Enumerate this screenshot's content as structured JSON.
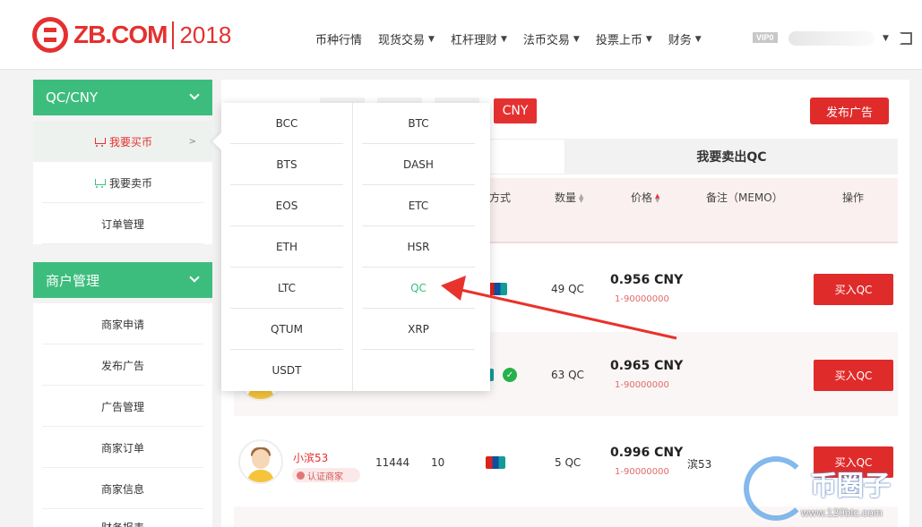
{
  "header": {
    "logo_text": "ZB.COM",
    "logo_year": "2018",
    "nav": [
      {
        "label": "币种行情",
        "caret": false
      },
      {
        "label": "现货交易",
        "caret": true
      },
      {
        "label": "杠杆理财",
        "caret": true
      },
      {
        "label": "法币交易",
        "caret": true
      },
      {
        "label": "投票上币",
        "caret": true
      },
      {
        "label": "财务",
        "caret": true
      }
    ],
    "vip_label": "VIP0"
  },
  "sidebar": {
    "group1_title": "QC/CNY",
    "group1_items": [
      {
        "label": "我要买币",
        "active": true,
        "icon": "cart-icon"
      },
      {
        "label": "我要卖币",
        "active": false,
        "icon": "cart-icon"
      },
      {
        "label": "订单管理",
        "active": false
      }
    ],
    "active_arrow": ">",
    "group2_title": "商户管理",
    "group2_items": [
      {
        "label": "商家申请"
      },
      {
        "label": "发布广告"
      },
      {
        "label": "广告管理"
      },
      {
        "label": "商家订单"
      },
      {
        "label": "商家信息"
      },
      {
        "label": "财务报表"
      }
    ]
  },
  "currency_selector": {
    "selected": "CNY",
    "publish_label": "发布广告"
  },
  "tabs": {
    "sell_label": "我要卖出QC"
  },
  "table": {
    "headers": {
      "payment": "款方式",
      "quantity": "数量",
      "price": "价格",
      "memo": "备注（MEMO）",
      "action": "操作"
    },
    "rows": [
      {
        "quantity": "49 QC",
        "price": "0.956 CNY",
        "range": "1-90000000",
        "button": "买入QC"
      },
      {
        "quantity": "63 QC",
        "price": "0.965 CNY",
        "range": "1-90000000",
        "button": "买入QC"
      },
      {
        "merchant": "小滨53",
        "badge": "认证商家",
        "orders": "11444",
        "rate": "10",
        "quantity": "5 QC",
        "price": "0.996 CNY",
        "range": "1-90000000",
        "memo": "滨53",
        "button": "买入QC"
      }
    ]
  },
  "dropdown": {
    "left": [
      "BCC",
      "BTS",
      "EOS",
      "ETH",
      "LTC",
      "QTUM",
      "USDT"
    ],
    "right": [
      "BTC",
      "DASH",
      "ETC",
      "HSR",
      "QC",
      "XRP"
    ],
    "active": "QC"
  },
  "watermark": {
    "title": "币圈子",
    "url": "www.120btc.com"
  },
  "colors": {
    "brand_red": "#e53030",
    "accent_green": "#3dbd7d",
    "arrow_red": "#e8322c"
  }
}
